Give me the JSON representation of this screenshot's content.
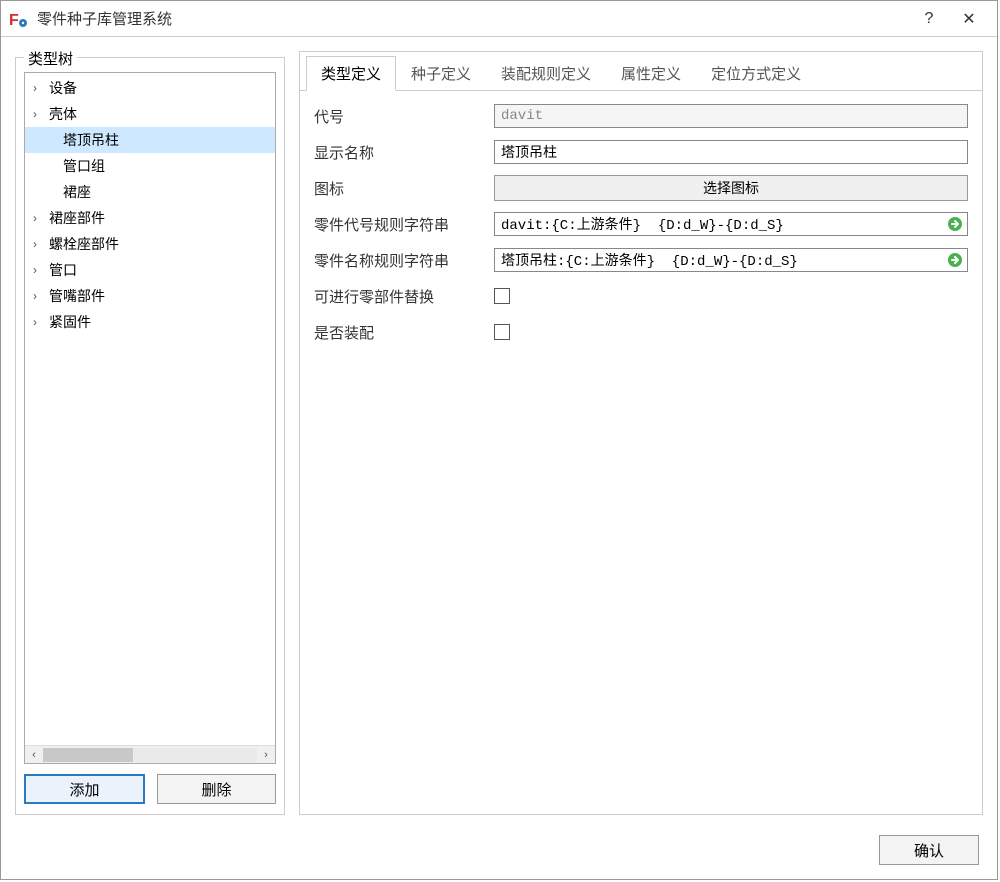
{
  "window": {
    "title": "零件种子库管理系统"
  },
  "sidebar": {
    "title": "类型树",
    "items": [
      {
        "label": "设备",
        "expandable": true
      },
      {
        "label": "壳体",
        "expandable": true
      },
      {
        "label": "塔顶吊柱",
        "expandable": false,
        "selected": true,
        "child": true
      },
      {
        "label": "管口组",
        "expandable": false,
        "child": true
      },
      {
        "label": "裙座",
        "expandable": false,
        "child": true
      },
      {
        "label": "裙座部件",
        "expandable": true
      },
      {
        "label": "螺栓座部件",
        "expandable": true
      },
      {
        "label": "管口",
        "expandable": true
      },
      {
        "label": "管嘴部件",
        "expandable": true
      },
      {
        "label": "紧固件",
        "expandable": true
      }
    ],
    "add_label": "添加",
    "delete_label": "删除"
  },
  "tabs": [
    {
      "label": "类型定义",
      "active": true
    },
    {
      "label": "种子定义"
    },
    {
      "label": "装配规则定义"
    },
    {
      "label": "属性定义"
    },
    {
      "label": "定位方式定义"
    }
  ],
  "form": {
    "code_label": "代号",
    "code_value": "davit",
    "name_label": "显示名称",
    "name_value": "塔顶吊柱",
    "icon_label": "图标",
    "icon_button": "选择图标",
    "code_rule_label": "零件代号规则字符串",
    "code_rule_value": "davit:{C:上游条件}  {D:d_W}-{D:d_S}",
    "name_rule_label": "零件名称规则字符串",
    "name_rule_value": "塔顶吊柱:{C:上游条件}  {D:d_W}-{D:d_S}",
    "replace_label": "可进行零部件替换",
    "assemble_label": "是否装配"
  },
  "footer": {
    "ok_label": "确认"
  }
}
